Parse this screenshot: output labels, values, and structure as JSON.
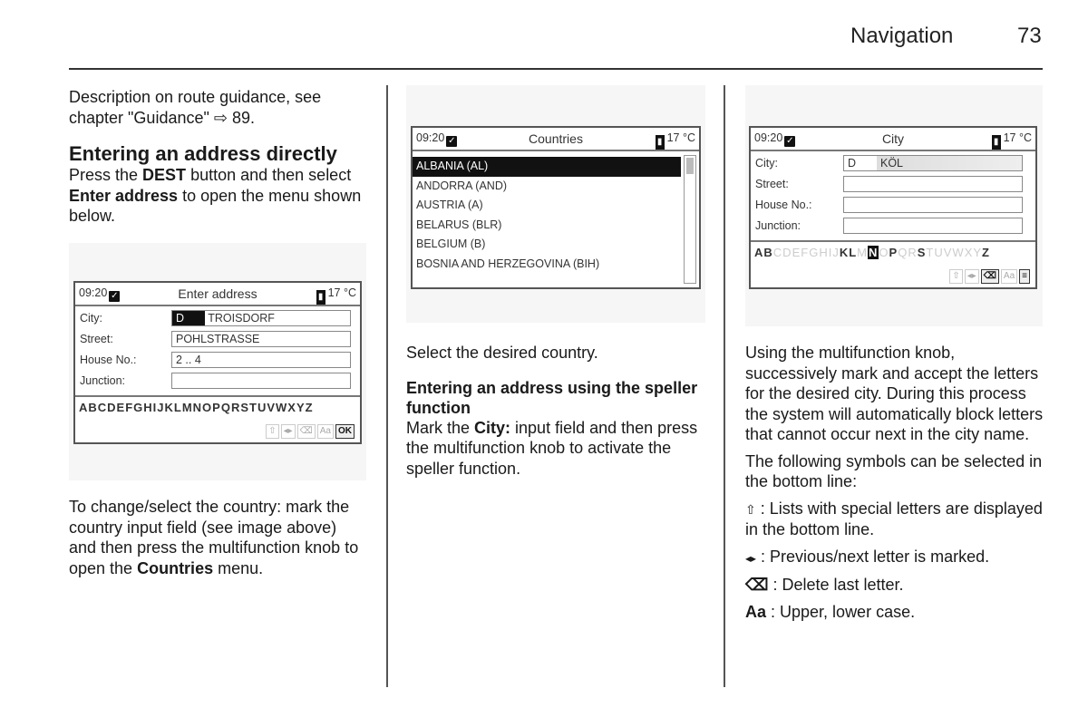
{
  "header": {
    "title": "Navigation",
    "page_number": "73"
  },
  "col1": {
    "intro": "Description on route guidance, see chapter \"Guidance\"",
    "intro_ref_icon": "arrow-reference-icon",
    "intro_ref_page": "89.",
    "heading": "Entering an address directly",
    "para1_a": "Press the ",
    "para1_b": "DEST",
    "para1_c": " button and then select ",
    "para1_d": "Enter address",
    "para1_e": " to open the menu shown below.",
    "para2_a": "To change/select the country: mark the country input field (see image above) and then press the multifunction knob to open the ",
    "para2_b": "Countries",
    "para2_c": " menu."
  },
  "screen_enter": {
    "time": "09:20",
    "title": "Enter address",
    "temp": "17 °C",
    "fields": [
      {
        "label": "City:",
        "country": "D",
        "value": "TROISDORF"
      },
      {
        "label": "Street:",
        "value": "POHLSTRASSE"
      },
      {
        "label": "House No.:",
        "value": "2 .. 4"
      },
      {
        "label": "Junction:",
        "value": ""
      }
    ],
    "letters": "ABCDEFGHIJKLMNOPQRSTUVWXYZ",
    "icons": [
      "⇧",
      "◂▸",
      "⌫",
      "Aa",
      "OK"
    ]
  },
  "col2": {
    "caption": "Select the desired country.",
    "heading": "Entering an address using the speller function",
    "para_a": "Mark the ",
    "para_b": "City:",
    "para_c": " input field and then press the multifunction knob to activate the speller function."
  },
  "screen_countries": {
    "time": "09:20",
    "title": "Countries",
    "temp": "17 °C",
    "items": [
      "ALBANIA (AL)",
      "ANDORRA (AND)",
      "AUSTRIA (A)",
      "BELARUS (BLR)",
      "BELGIUM (B)",
      "BOSNIA AND HERZEGOVINA (BIH)"
    ],
    "selected_index": 0
  },
  "col3": {
    "para1": "Using the multifunction knob, successively mark and accept the letters for the desired city. During this process the system will automatically block letters that cannot occur next in the city name.",
    "para2": "The following symbols can be selected in the bottom line:",
    "sym1_icon": "⇧",
    "sym1_text": " : Lists with special letters are displayed in the bottom line.",
    "sym2_icon": "◂▸",
    "sym2_text": " : Previous/next letter is marked.",
    "sym3_icon": "⌫",
    "sym3_text": " : Delete last letter.",
    "sym4_icon": "Aa",
    "sym4_text": " : Upper, lower case."
  },
  "screen_city": {
    "time": "09:20",
    "title": "City",
    "temp": "17 °C",
    "fields": [
      {
        "label": "City:",
        "country": "D",
        "value": "KÖL"
      },
      {
        "label": "Street:",
        "value": ""
      },
      {
        "label": "House No.:",
        "value": ""
      },
      {
        "label": "Junction:",
        "value": ""
      }
    ],
    "letters": "ABCDEFGHIJKLMNOPQRSTUVWXYZ",
    "active_letters": "ABKLNPSZ",
    "selected_letter": "N",
    "icons": [
      "⇧",
      "◂▸",
      "⌫",
      "Aa",
      "≡"
    ]
  }
}
